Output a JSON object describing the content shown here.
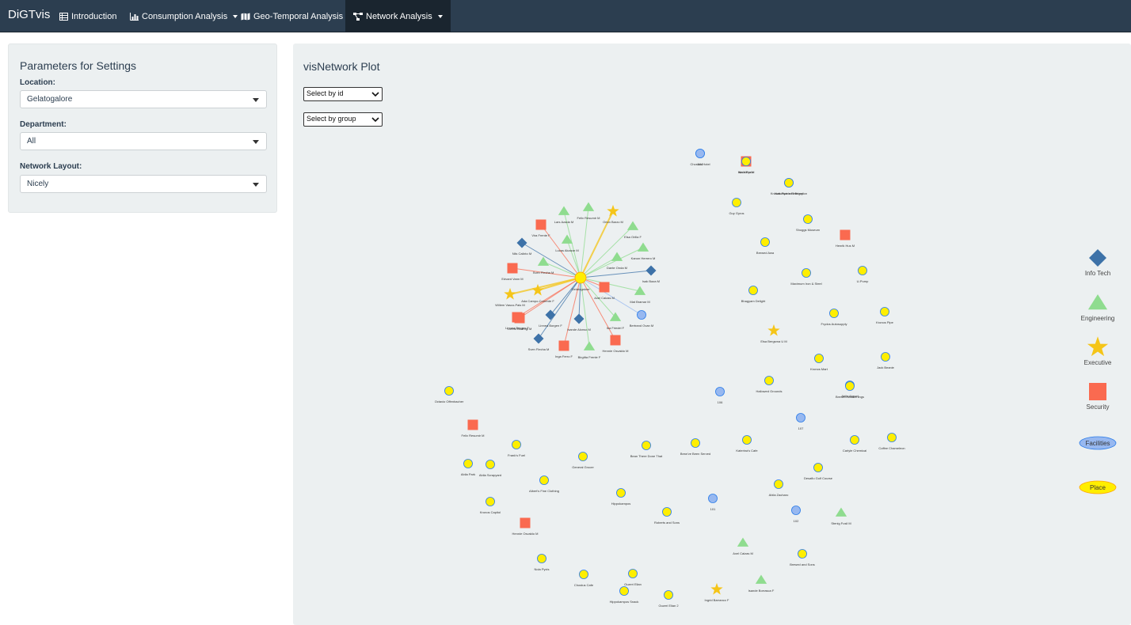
{
  "navbar": {
    "brand": "DiGTvis",
    "items": [
      {
        "label": "Introduction",
        "icon": "table-icon",
        "dropdown": false,
        "active": false
      },
      {
        "label": "Consumption Analysis",
        "icon": "bar-chart-icon",
        "dropdown": true,
        "active": false
      },
      {
        "label": "Geo-Temporal Analysis",
        "icon": "map-icon",
        "dropdown": true,
        "active": false
      },
      {
        "label": "Network Analysis",
        "icon": "network-icon",
        "dropdown": true,
        "active": true
      }
    ]
  },
  "sidebar": {
    "title": "Parameters for Settings",
    "fields": [
      {
        "label": "Location:",
        "value": "Gelatogalore"
      },
      {
        "label": "Department:",
        "value": "All"
      },
      {
        "label": "Network Layout:",
        "value": "Nicely"
      }
    ]
  },
  "main": {
    "title": "visNetwork Plot",
    "select_id": "Select by id",
    "select_group": "Select by group"
  },
  "legend": [
    {
      "label": "Info Tech",
      "shape": "diamond",
      "color": "#3d72a8"
    },
    {
      "label": "Engineering",
      "shape": "triangle",
      "color": "#8fdc8f"
    },
    {
      "label": "Executive",
      "shape": "star",
      "color": "#f5c518"
    },
    {
      "label": "Security",
      "shape": "square",
      "color": "#fa6a50"
    },
    {
      "label": "Facilities",
      "shape": "ellipse",
      "color": "#97b8f0"
    },
    {
      "label": "Place",
      "shape": "ellipse",
      "color": "#ffee00"
    }
  ],
  "network": {
    "hub": "Gelatogalore",
    "hub_color": "#ffee00",
    "nodes": [
      {
        "label": "Lars Azada M",
        "group": "Engineering",
        "linked": true
      },
      {
        "label": "Felix Resumir M",
        "group": "Engineering",
        "linked": true
      },
      {
        "label": "Orion Barzo M",
        "group": "Executive",
        "linked": true
      },
      {
        "label": "Vira Frente F",
        "group": "Security",
        "linked": true
      },
      {
        "label": "Linnea Bergen F",
        "group": "Security",
        "linked": true
      },
      {
        "label": "Elsa Orilla F",
        "group": "Engineering",
        "linked": true
      },
      {
        "label": "Lucas Alcazar M",
        "group": "Engineering",
        "linked": true
      },
      {
        "label": "Nils Calixto M",
        "group": "Info Tech",
        "linked": true
      },
      {
        "label": "Kanon Herrero M",
        "group": "Engineering",
        "linked": true
      },
      {
        "label": "Dante Onda M",
        "group": "Engineering",
        "linked": true
      },
      {
        "label": "Sven Flecha M",
        "group": "Engineering",
        "linked": true
      },
      {
        "label": "Isak Baza M",
        "group": "Info Tech",
        "linked": true
      },
      {
        "label": "Edvard Vann M",
        "group": "Security",
        "linked": true
      },
      {
        "label": "Willem Vasco-Pais M",
        "group": "Executive",
        "linked": true
      },
      {
        "label": "Ada Campo-Corrente F",
        "group": "Executive",
        "linked": true
      },
      {
        "label": "Axel Calzas M",
        "group": "Security",
        "linked": true
      },
      {
        "label": "Mat Bramar M",
        "group": "Engineering",
        "linked": true
      },
      {
        "label": "Loreto Bodrogi M",
        "group": "Security",
        "linked": true
      },
      {
        "label": "Linnea Borgen F",
        "group": "Info Tech",
        "linked": true
      },
      {
        "label": "Isande Alonso M",
        "group": "Info Tech",
        "linked": true
      },
      {
        "label": "Ika Friedel F",
        "group": "Engineering",
        "linked": true
      },
      {
        "label": "Bertrand Ovan M",
        "group": "Facilities",
        "linked": true
      },
      {
        "label": "Sven Flecha M",
        "group": "Info Tech",
        "linked": true
      },
      {
        "label": "Inga Ferro F",
        "group": "Security",
        "linked": true
      },
      {
        "label": "Birgitta Frente F",
        "group": "Engineering",
        "linked": true
      },
      {
        "label": "Hennie Osvaldo M",
        "group": "Security",
        "linked": true
      },
      {
        "label": "Chostus Hotel",
        "group": "Place",
        "linked": false
      },
      {
        "label": "Isia Vann M",
        "group": "Security",
        "linked": false
      },
      {
        "label": "Nationwide Refinery",
        "group": "Place",
        "linked": false
      },
      {
        "label": "Guy Gyros",
        "group": "Place",
        "linked": false
      },
      {
        "label": "Shoggs Museum",
        "group": "Place",
        "linked": false
      },
      {
        "label": "Henrik Hus M",
        "group": "Security",
        "linked": false
      },
      {
        "label": "Brewed Awa",
        "group": "Place",
        "linked": false
      },
      {
        "label": "Maximum Iron & Steel",
        "group": "Place",
        "linked": false
      },
      {
        "label": "U-Pump",
        "group": "Place",
        "linked": false
      },
      {
        "label": "Bhagyam Delight",
        "group": "Place",
        "linked": false
      },
      {
        "label": "Frydos Autosupply",
        "group": "Place",
        "linked": false
      },
      {
        "label": "Kronos Pipe",
        "group": "Place",
        "linked": false
      },
      {
        "label": "Elsa Bergsma U M",
        "group": "Executive",
        "linked": false
      },
      {
        "label": "Kronos Mart",
        "group": "Place",
        "linked": false
      },
      {
        "label": "Jack Beanie",
        "group": "Place",
        "linked": false
      },
      {
        "label": "Hallowed Grounds",
        "group": "Place",
        "linked": false
      },
      {
        "label": "Abila Airport",
        "group": "Place",
        "linked": false
      },
      {
        "label": "Brewed Awakenings",
        "group": "Place",
        "linked": false
      },
      {
        "label": "Coffee Chameleon",
        "group": "Place",
        "linked": false
      },
      {
        "label": "Carlyle Chemical",
        "group": "Place",
        "linked": false
      },
      {
        "label": "Ouzeri Elian",
        "group": "Place",
        "linked": false
      },
      {
        "label": "Desafio Golf Course",
        "group": "Place",
        "linked": false
      },
      {
        "label": "Abila Zacharo",
        "group": "Place",
        "linked": false
      },
      {
        "label": "Roberts and Sons",
        "group": "Place",
        "linked": false
      },
      {
        "label": "Hippokampos",
        "group": "Place",
        "linked": false
      },
      {
        "label": "General Grocer",
        "group": "Place",
        "linked": false
      },
      {
        "label": "Albert's Fine Clothing",
        "group": "Place",
        "linked": false
      },
      {
        "label": "Bean There Done That",
        "group": "Place",
        "linked": false
      },
      {
        "label": "Brew've Been Served",
        "group": "Place",
        "linked": false
      },
      {
        "label": "Katerina's Cafe",
        "group": "Place",
        "linked": false
      },
      {
        "label": "Frank's Fuel",
        "group": "Place",
        "linked": false
      },
      {
        "label": "Abila Scrapyard",
        "group": "Place",
        "linked": false
      },
      {
        "label": "Octavio Offenbacher",
        "group": "Place",
        "linked": false
      },
      {
        "label": "Felix Resumir M",
        "group": "Security",
        "linked": false
      },
      {
        "label": "Abila Park",
        "group": "Place",
        "linked": false
      },
      {
        "label": "Kronos Capitol",
        "group": "Place",
        "linked": false
      },
      {
        "label": "Hennie Osvaldo M",
        "group": "Security",
        "linked": false
      },
      {
        "label": "Nola Pyxis",
        "group": "Place",
        "linked": false
      },
      {
        "label": "Chostus Cafe",
        "group": "Place",
        "linked": false
      },
      {
        "label": "Hippokampos Snack",
        "group": "Place",
        "linked": false
      },
      {
        "label": "Ouzeri Elian 2",
        "group": "Place",
        "linked": false
      },
      {
        "label": "Ingrid Barranco F",
        "group": "Executive",
        "linked": false
      },
      {
        "label": "Stenig Fusil M",
        "group": "Engineering",
        "linked": false
      },
      {
        "label": "Axel Calzas M",
        "group": "Engineering",
        "linked": false
      },
      {
        "label": "Brewed and Sons",
        "group": "Place",
        "linked": false
      },
      {
        "label": "Isande Borrasca F",
        "group": "Engineering",
        "linked": false
      },
      {
        "label": "106",
        "group": "Facilities",
        "linked": false
      },
      {
        "label": "107",
        "group": "Facilities",
        "linked": false
      },
      {
        "label": "101",
        "group": "Facilities",
        "linked": false
      },
      {
        "label": "102",
        "group": "Facilities",
        "linked": false
      },
      {
        "label": "104",
        "group": "Facilities",
        "linked": false
      },
      {
        "label": "Nola Pyxis",
        "group": "Place",
        "linked": false
      },
      {
        "label": "Kronos Pipe and Irrigation",
        "group": "Place",
        "linked": false
      }
    ]
  }
}
